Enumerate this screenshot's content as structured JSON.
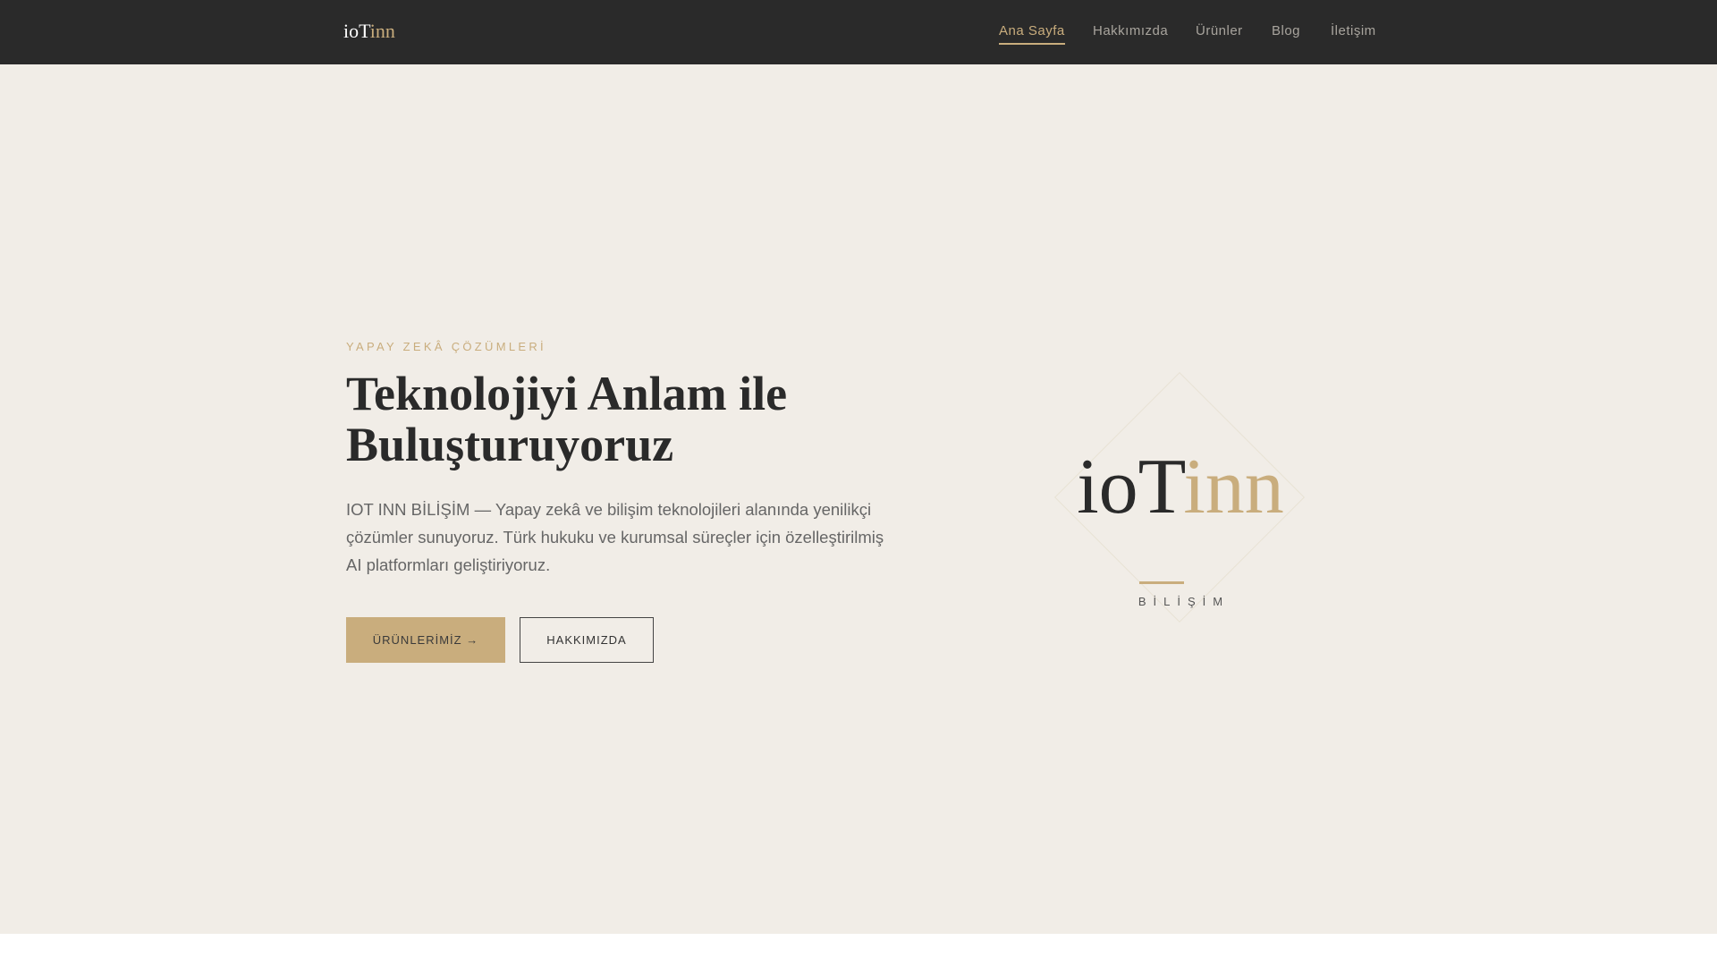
{
  "nav": {
    "brand_a": "ioT",
    "brand_b": "inn",
    "items": [
      "Ana Sayfa",
      "Hakkımızda",
      "Ürünler",
      "Blog",
      "İletişim"
    ]
  },
  "hero": {
    "eyebrow": "YAPAY ZEKÂ ÇÖZÜMLERİ",
    "title_line1": "Teknolojiyi Anlam ile",
    "title_line2": "Buluşturuyoruz",
    "lead": "IOT INN BİLİŞİM — Yapay zekâ ve bilişim teknolojileri alanında yenilikçi çözümler sunuyoruz. Türk hukuku ve kurumsal süreçler için özelleştirilmiş AI platformları geliştiriyoruz.",
    "primary_button": "ÜRÜNLERİMİZ →",
    "secondary_button": "HAKKIMIZDA"
  },
  "logo": {
    "text_a": "ioT",
    "text_b": "inn",
    "subtitle": "BİLİŞİM"
  },
  "colors": {
    "accent": "#c9ad7d",
    "nav_bg": "#2a2a2a",
    "hero_bg": "#f1ede7"
  }
}
